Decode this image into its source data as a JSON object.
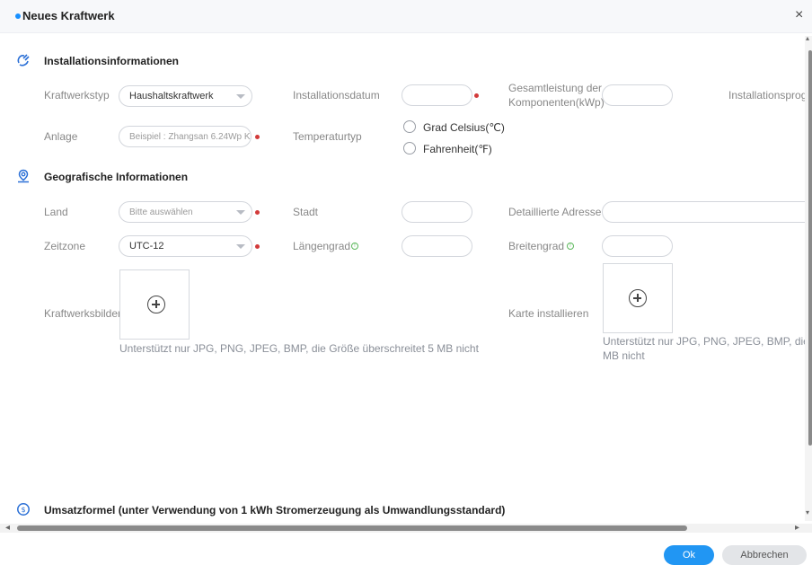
{
  "dialog": {
    "title": "Neues Kraftwerk",
    "close_glyph": "×"
  },
  "sections": {
    "install": {
      "title": "Installationsinformationen",
      "icon": "install-icon"
    },
    "geo": {
      "title": "Geografische Informationen",
      "icon": "location-pin-icon"
    },
    "revenue": {
      "title": "Umsatzformel (unter Verwendung von 1 kWh Stromerzeugung als Umwandlungsstandard)",
      "icon": "currency-icon"
    }
  },
  "install": {
    "plant_type_label": "Kraftwerkstyp",
    "plant_type_value": "Haushaltskraftwerk",
    "install_date_label": "Installationsdatum",
    "install_date_value": "",
    "total_power_label_1": "Gesamtleistung der",
    "total_power_label_2": "Komponenten(kWp)",
    "total_power_value": "",
    "install_progress_label": "Installationsprog",
    "plant_label": "Anlage",
    "plant_placeholder": "Beispiel : Zhangsan 6.24Wp K",
    "temp_type_label": "Temperaturtyp",
    "temp_options": [
      "Grad Celsius(℃)",
      "Fahrenheit(℉)"
    ]
  },
  "geo": {
    "country_label": "Land",
    "country_placeholder": "Bitte auswählen",
    "city_label": "Stadt",
    "city_value": "",
    "address_label": "Detaillierte Adresse",
    "address_value": "",
    "timezone_label": "Zeitzone",
    "timezone_value": "UTC-12",
    "longitude_label": "Längengrad",
    "longitude_value": "",
    "latitude_label": "Breitengrad",
    "latitude_value": "",
    "info_glyph": "!"
  },
  "uploads": {
    "plant_images_label": "Kraftwerksbilder",
    "plant_images_hint": "Unterstützt nur JPG, PNG, JPEG, BMP, die Größe überschreitet 5 MB nicht",
    "map_label": "Karte installieren",
    "map_hint_1": "Unterstützt nur JPG, PNG, JPEG, BMP, die Grö",
    "map_hint_2": "MB nicht"
  },
  "scroll": {
    "left_arrow": "◂",
    "right_arrow": "▸",
    "up_arrow": "▴",
    "down_arrow": "▾"
  },
  "footer": {
    "ok_label": "Ok",
    "cancel_label": "Abbrechen"
  },
  "colors": {
    "accent": "#2196f3",
    "required": "#d23a3a",
    "info": "#5cb85c"
  }
}
